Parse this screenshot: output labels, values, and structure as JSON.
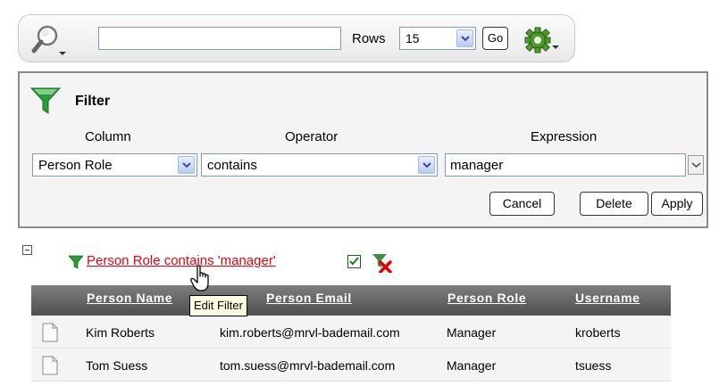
{
  "search": {
    "value": "",
    "rows_label": "Rows",
    "rows_value": "15",
    "go_label": "Go"
  },
  "filter": {
    "title": "Filter",
    "headers": {
      "column": "Column",
      "operator": "Operator",
      "expression": "Expression"
    },
    "column_value": "Person Role",
    "operator_value": "contains",
    "expression_value": "manager",
    "buttons": {
      "cancel": "Cancel",
      "delete": "Delete",
      "apply": "Apply"
    }
  },
  "active_filter": {
    "text": "Person Role contains 'manager'",
    "enabled": true
  },
  "tooltip": "Edit Filter",
  "table": {
    "columns": [
      "Person Name",
      "Person Email",
      "Person Role",
      "Username"
    ],
    "rows": [
      [
        "Kim Roberts",
        "kim.roberts@mrvl-bademail.com",
        "Manager",
        "kroberts"
      ],
      [
        "Tom Suess",
        "tom.suess@mrvl-bademail.com",
        "Manager",
        "tsuess"
      ]
    ]
  },
  "colors": {
    "filter_link": "#e8000d",
    "header_bg": "#5f5f5f",
    "funnel": "#1f8a2e",
    "accent_select": "#b9cbf5"
  },
  "icons": [
    "search-icon",
    "gear-icon",
    "funnel-icon",
    "remove-filter-icon",
    "document-icon",
    "hand-cursor-icon",
    "checkbox-icon"
  ]
}
